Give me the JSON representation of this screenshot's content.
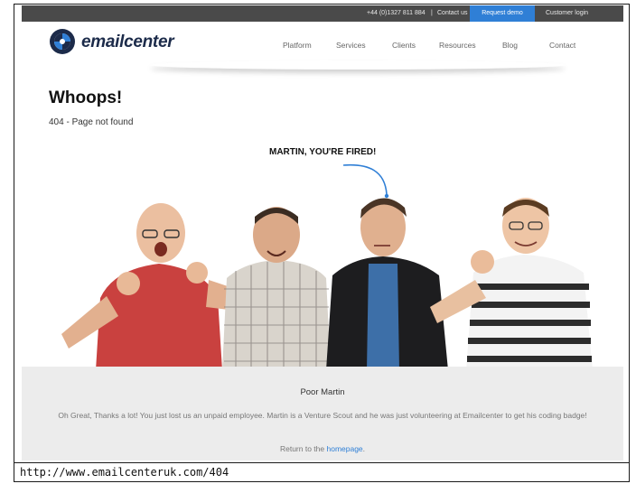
{
  "topbar": {
    "phone": "+44 (0)1327 811 884",
    "separator": "|",
    "contact_link": "Contact us",
    "demo_button": "Request demo",
    "login_link": "Customer login",
    "demo_color": "#2f7fd6"
  },
  "header": {
    "logo_text": "emailcenter",
    "nav": [
      "Platform",
      "Services",
      "Clients",
      "Resources",
      "Blog",
      "Contact"
    ]
  },
  "main": {
    "headline": "Whoops!",
    "subline": "404 - Page not found",
    "callout": "MARTIN, YOU'RE FIRED!"
  },
  "footer_box": {
    "title": "Poor Martin",
    "message": "Oh Great, Thanks a lot! You just lost us an unpaid employee. Martin is a Venture Scout and he was just volunteering at Emailcenter to get his coding badge!",
    "return_prefix": "Return to the ",
    "return_link": "homepage",
    "return_suffix": "."
  },
  "url": "http://www.emailcenteruk.com/404"
}
